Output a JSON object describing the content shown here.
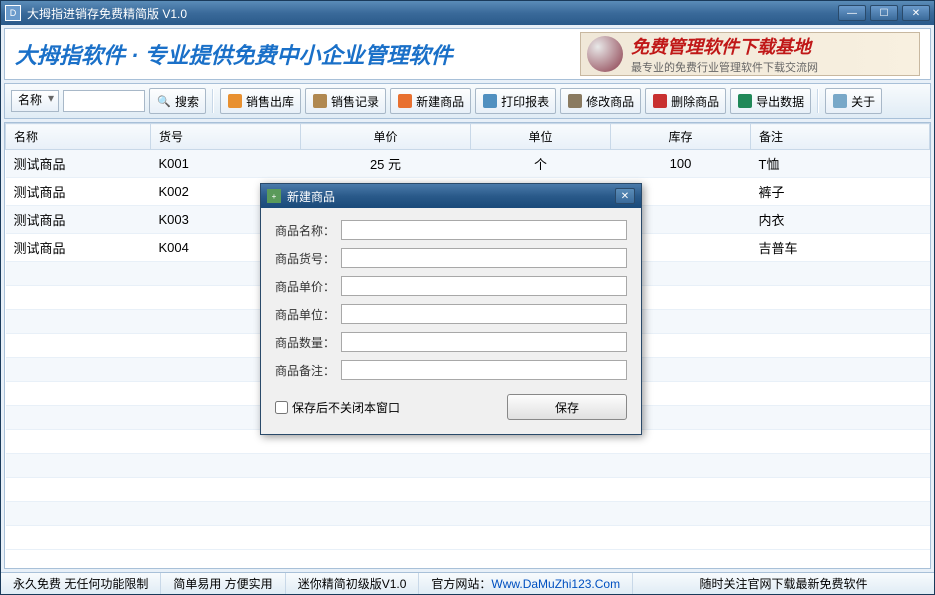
{
  "window": {
    "title": "大拇指进销存免费精简版 V1.0"
  },
  "banner": {
    "title": "大拇指软件 · 专业提供免费中小企业管理软件",
    "ad_line1": "免费管理软件下载基地",
    "ad_line2": "最专业的免费行业管理软件下载交流网"
  },
  "toolbar": {
    "filter_field": "名称",
    "search": "搜索",
    "sale_out": "销售出库",
    "sale_record": "销售记录",
    "new_product": "新建商品",
    "print_report": "打印报表",
    "edit_product": "修改商品",
    "delete_product": "删除商品",
    "export_data": "导出数据",
    "about": "关于"
  },
  "table": {
    "headers": {
      "name": "名称",
      "code": "货号",
      "price": "单价",
      "unit": "单位",
      "stock": "库存",
      "remark": "备注"
    },
    "rows": [
      {
        "name": "测试商品",
        "code": "K001",
        "price": "25 元",
        "unit": "个",
        "stock": "100",
        "remark": "T恤"
      },
      {
        "name": "测试商品",
        "code": "K002",
        "price": "",
        "unit": "",
        "stock": "",
        "remark": "裤子"
      },
      {
        "name": "测试商品",
        "code": "K003",
        "price": "",
        "unit": "",
        "stock": "",
        "remark": "内衣"
      },
      {
        "name": "测试商品",
        "code": "K004",
        "price": "",
        "unit": "",
        "stock": "",
        "remark": "吉普车"
      }
    ]
  },
  "dialog": {
    "title": "新建商品",
    "fields": {
      "name": "商品名称：",
      "code": "商品货号：",
      "price": "商品单价：",
      "unit": "商品单位：",
      "qty": "商品数量：",
      "remark": "商品备注："
    },
    "keep_open": "保存后不关闭本窗口",
    "save": "保存"
  },
  "statusbar": {
    "s1": "永久免费 无任何功能限制",
    "s2": "简单易用 方便实用",
    "s3": "迷你精简初级版V1.0",
    "s4_label": "官方网站：",
    "s4_link": "Www.DaMuZhi123.Com",
    "s5": "随时关注官网下载最新免费软件"
  }
}
